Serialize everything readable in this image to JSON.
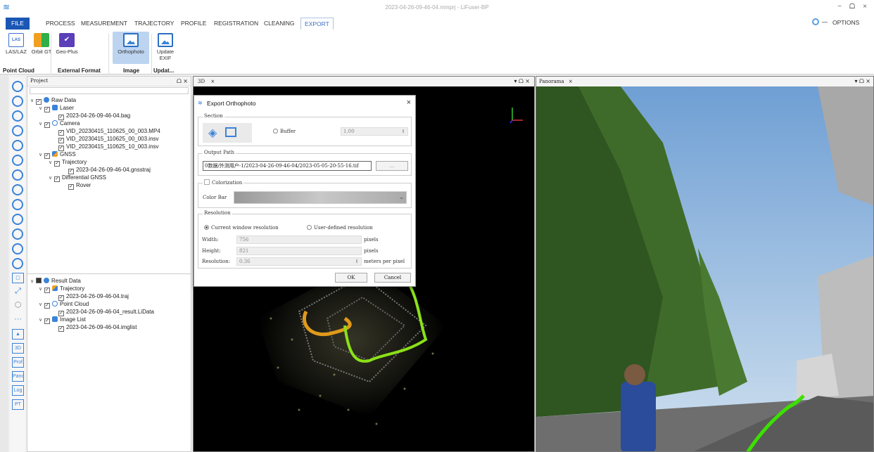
{
  "window": {
    "title": "2023-04-26-09-46-04.mmprj - LiFuser-BP",
    "minimize": "−",
    "restore": "ᗝ",
    "close": "×"
  },
  "menu": {
    "tabs": [
      "FILE",
      "PROCESS",
      "MEASUREMENT",
      "TRAJECTORY",
      "PROFILE",
      "REGISTRATION",
      "CLEANING",
      "EXPORT"
    ],
    "options_label": "OPTIONS"
  },
  "ribbon": {
    "buttons": [
      {
        "label": "LAS/LAZ",
        "icon": "las-icon"
      },
      {
        "label": "Orbit GT",
        "icon": "orbit-icon"
      },
      {
        "label": "Geo-Plus",
        "icon": "geoplus-icon"
      },
      {
        "label": "Orthophoto",
        "icon": "orthophoto-icon"
      },
      {
        "label": "Update EXIF",
        "icon": "update-exif-icon"
      }
    ],
    "groups": [
      "Point Cloud",
      "External Format",
      "Image",
      "Updat..."
    ]
  },
  "project": {
    "title": "Project",
    "raw_tree": [
      "Raw Data",
      "Laser",
      "2023-04-26-09-46-04.bag",
      "Camera",
      "VID_20230415_110625_00_003.MP4",
      "VID_20230415_110625_00_003.insv",
      "VID_20230415_110625_10_003.insv",
      "GNSS",
      "Trajectory",
      "2023-04-26-09-46-04.gnsstraj",
      "Differential GNSS",
      "Rover"
    ],
    "result_tree": [
      "Result Data",
      "Trajectory",
      "2023-04-26-09-46-04.traj",
      "Point Cloud",
      "2023-04-26-09-46-04_result.LiData",
      "Image List",
      "2023-04-26-09-46-04.imglist"
    ]
  },
  "left_toolbar": [
    "3D",
    "Prof",
    "Pano",
    "Log",
    "PT"
  ],
  "panels": {
    "view3d": "3D",
    "panorama": "Panorama"
  },
  "dialog": {
    "title": "Export Orthophoto",
    "section_label": "Section",
    "buffer_label": "Buffer",
    "buffer_value": "1.00",
    "output_label": "Output Path",
    "output_path": "0数据/外测用户-1/2023-04-26-09-46-04/2023-05-05-20-55-16.tif",
    "browse_label": "...",
    "colorization_label": "Colorization",
    "color_bar_label": "Color Bar",
    "resolution_label": "Resolution",
    "current_res": "Current window resolution",
    "user_res": "User-defined resolution",
    "width_label": "Width:",
    "width_value": "756",
    "width_unit": "pixels",
    "height_label": "Height:",
    "height_value": "821",
    "height_unit": "pixels",
    "res_label": "Resolution:",
    "res_value": "0.36",
    "res_unit": "meters per pixel",
    "ok": "OK",
    "cancel": "Cancel"
  },
  "colors": {
    "accent": "#1a57b5",
    "trajectory_green": "#8be018",
    "trajectory_orange": "#e09a1a"
  }
}
